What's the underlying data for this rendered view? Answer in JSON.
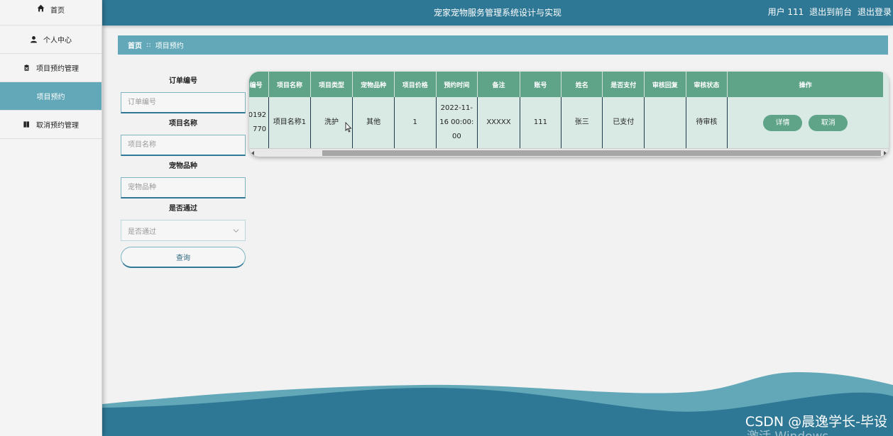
{
  "header": {
    "title": "宠家宠物服务管理系统设计与实现",
    "user_label": "用户 111",
    "to_front": "退出到前台",
    "logout": "退出登录"
  },
  "sidebar": {
    "items": [
      {
        "label": "首页",
        "icon": "home-icon"
      },
      {
        "label": "个人中心",
        "icon": "user-icon"
      },
      {
        "label": "项目预约管理",
        "icon": "clipboard-icon"
      },
      {
        "label": "项目预约",
        "icon": ""
      },
      {
        "label": "取消预约管理",
        "icon": "book-icon"
      }
    ]
  },
  "breadcrumb": {
    "home": "首页",
    "separator": "::",
    "current": "项目预约"
  },
  "search": {
    "order_label": "订单编号",
    "order_placeholder": "订单编号",
    "name_label": "项目名称",
    "name_placeholder": "项目名称",
    "breed_label": "宠物品种",
    "breed_placeholder": "宠物品种",
    "pass_label": "是否通过",
    "pass_placeholder": "是否通过",
    "query_button": "查询"
  },
  "table": {
    "headers": [
      "编号",
      "项目名称",
      "项目类型",
      "宠物品种",
      "项目价格",
      "预约时间",
      "备注",
      "账号",
      "姓名",
      "是否支付",
      "审核回复",
      "审核状态",
      "操作"
    ],
    "rows": [
      {
        "order_no": "0192770",
        "project_name": "项目名称1",
        "project_type": "洗护",
        "breed": "其他",
        "price": "1",
        "time": "2022-11-16 00:00:00",
        "note": "XXXXX",
        "account": "111",
        "name": "张三",
        "paid": "已支付",
        "reply": "",
        "status": "待审核",
        "detail_btn": "详情",
        "cancel_btn": "取消"
      }
    ]
  },
  "watermark": "CSDN @晨逸学长-毕设",
  "activate_text": "激活 Windows",
  "colors": {
    "header": "#2e7896",
    "accent": "#62a8b8",
    "table_header": "#5fa388",
    "table_cell": "#d9e9e3"
  }
}
